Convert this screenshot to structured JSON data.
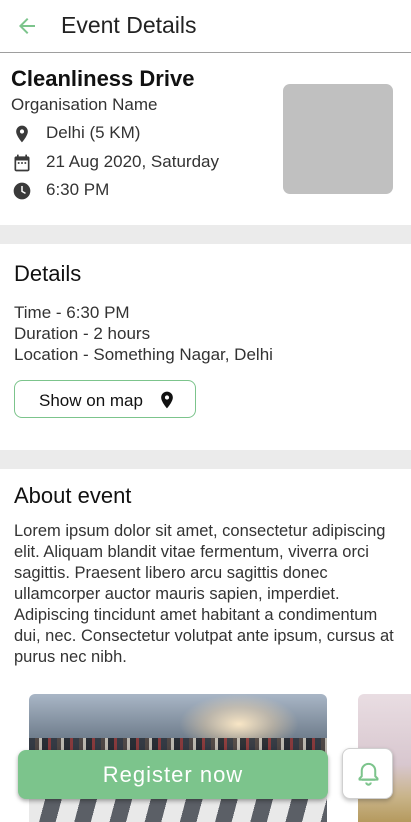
{
  "appbar": {
    "title": "Event Details",
    "back_icon": "arrow-left-icon",
    "accent": "#7cc48c"
  },
  "event": {
    "title": "Cleanliness Drive",
    "organisation": "Organisation Name",
    "location": "Delhi (5 KM)",
    "date": "21 Aug 2020, Saturday",
    "time": "6:30 PM",
    "icons": [
      "location-pin-icon",
      "calendar-icon",
      "clock-icon"
    ]
  },
  "details": {
    "heading": "Details",
    "lines": [
      "Time - 6:30 PM",
      "Duration - 2 hours",
      "Location - Something Nagar, Delhi"
    ],
    "map_button_label": "Show on map"
  },
  "about": {
    "heading": "About event",
    "text": "Lorem ipsum dolor sit amet, consectetur adipiscing elit. Aliquam blandit vitae fermentum, viverra orci sagittis. Praesent libero arcu sagittis donec ullamcorper auctor mauris sapien, imperdiet. Adipiscing tincidunt amet habitant a condimentum dui, nec. Consectetur volutpat ante ipsum, cursus at purus nec nibh."
  },
  "actions": {
    "register_label": "Register now",
    "bell_icon": "bell-icon"
  },
  "colors": {
    "accent_green": "#7cc48c",
    "divider": "#ebebeb",
    "placeholder": "#c0c0c0"
  }
}
